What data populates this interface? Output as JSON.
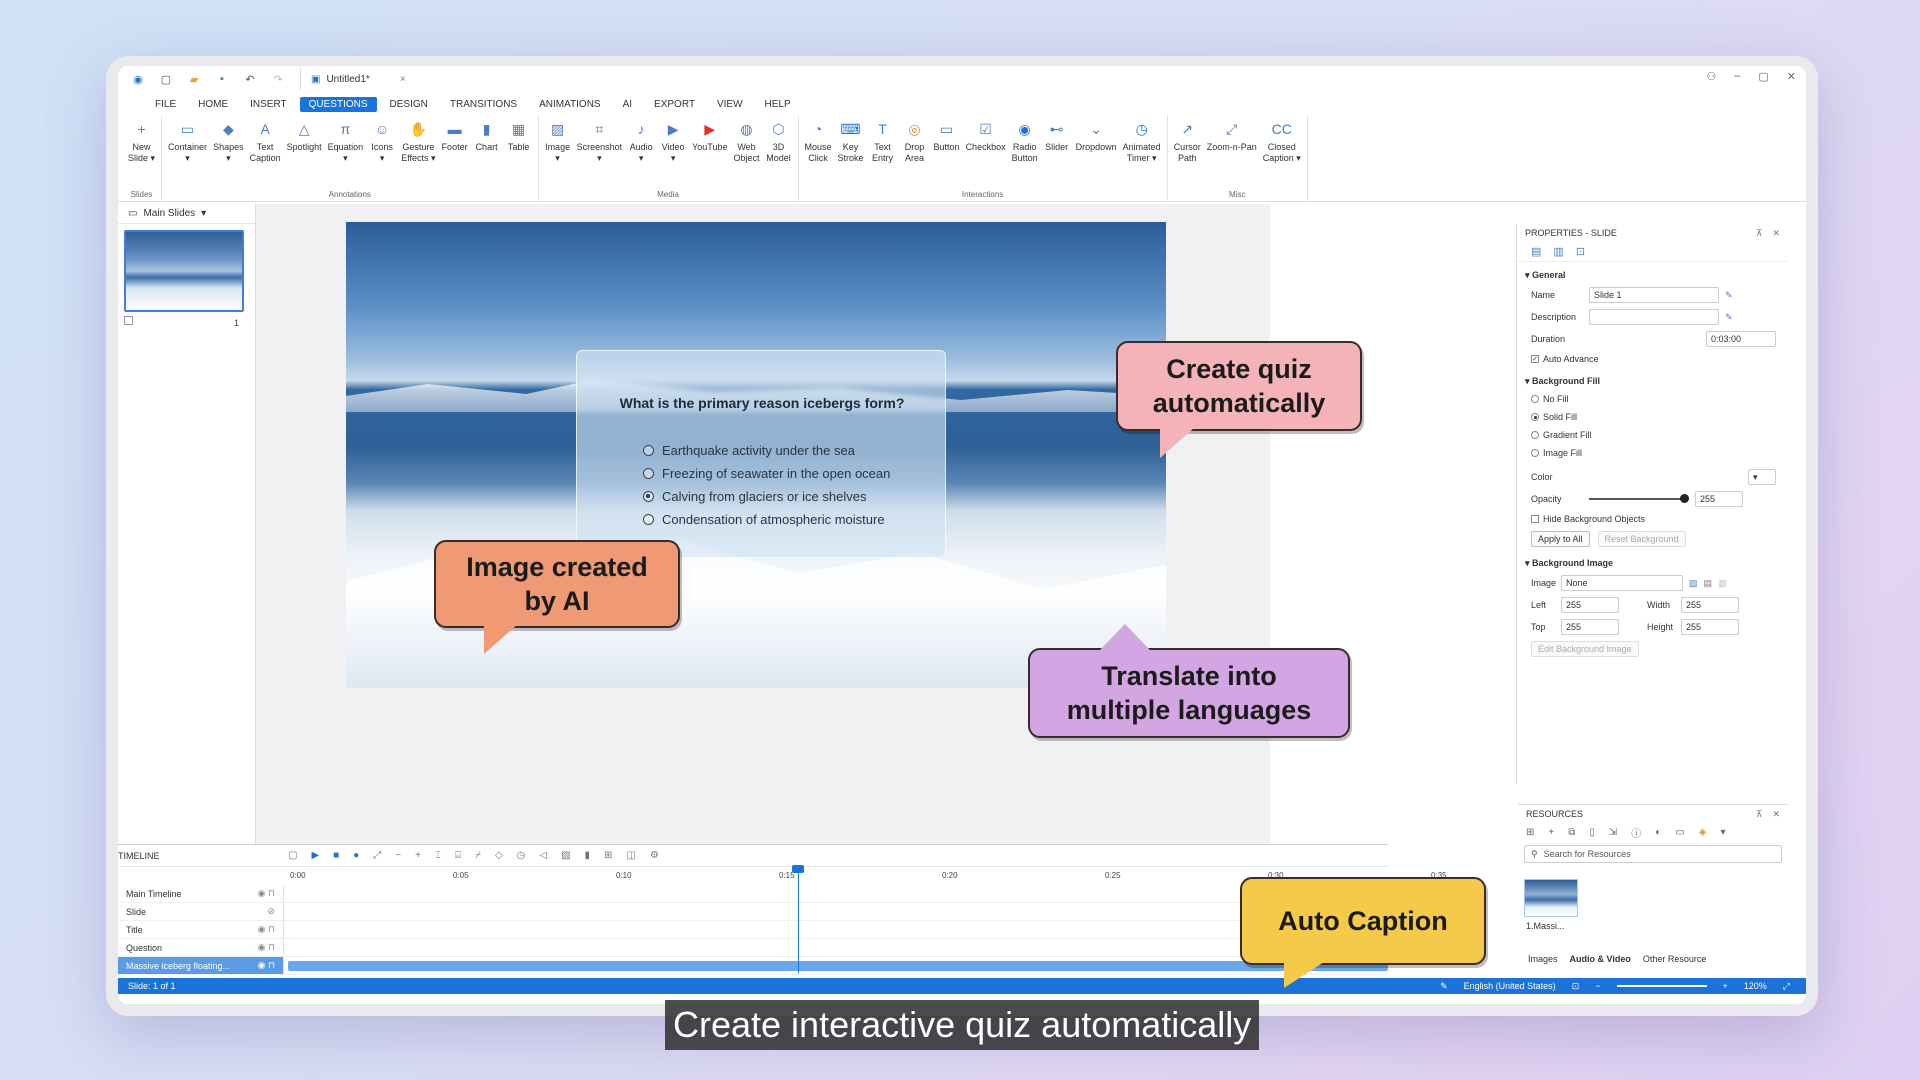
{
  "titlebar": {
    "doc_title": "Untitled1*",
    "close": "×"
  },
  "menu": [
    "FILE",
    "HOME",
    "INSERT",
    "QUESTIONS",
    "DESIGN",
    "TRANSITIONS",
    "ANIMATIONS",
    "AI",
    "EXPORT",
    "VIEW",
    "HELP"
  ],
  "ribbon": {
    "groups": [
      {
        "label": "Slides",
        "items": [
          {
            "label": "New\nSlide ▾",
            "icon": "+"
          }
        ]
      },
      {
        "label": "Annotations",
        "items": [
          {
            "label": "Container\n▾",
            "icon": "▭"
          },
          {
            "label": "Shapes\n▾",
            "icon": "◆"
          },
          {
            "label": "Text\nCaption",
            "icon": "A"
          },
          {
            "label": "Spotlight",
            "icon": "△"
          },
          {
            "label": "Equation\n▾",
            "icon": "π"
          },
          {
            "label": "Icons\n▾",
            "icon": "☺"
          },
          {
            "label": "Gesture\nEffects ▾",
            "icon": "✋"
          },
          {
            "label": "Footer",
            "icon": "▬"
          },
          {
            "label": "Chart",
            "icon": "▮"
          },
          {
            "label": "Table",
            "icon": "▦"
          }
        ]
      },
      {
        "label": "Media",
        "items": [
          {
            "label": "Image\n▾",
            "icon": "▨"
          },
          {
            "label": "Screenshot\n▾",
            "icon": "⌗"
          },
          {
            "label": "Audio\n▾",
            "icon": "♪"
          },
          {
            "label": "Video\n▾",
            "icon": "▶"
          },
          {
            "label": "YouTube",
            "icon": "▶"
          },
          {
            "label": "Web\nObject",
            "icon": "◍"
          },
          {
            "label": "3D\nModel",
            "icon": "⬡"
          }
        ]
      },
      {
        "label": "Interactions",
        "items": [
          {
            "label": "Mouse\nClick",
            "icon": "◔"
          },
          {
            "label": "Key\nStroke",
            "icon": "⌨"
          },
          {
            "label": "Text\nEntry",
            "icon": "T"
          },
          {
            "label": "Drop\nArea",
            "icon": "◎"
          },
          {
            "label": "Button",
            "icon": "▭"
          },
          {
            "label": "Checkbox",
            "icon": "☑"
          },
          {
            "label": "Radio\nButton",
            "icon": "◉"
          },
          {
            "label": "Slider",
            "icon": "⊷"
          },
          {
            "label": "Dropdown",
            "icon": "⌄"
          },
          {
            "label": "Animated\nTimer ▾",
            "icon": "◷"
          }
        ]
      },
      {
        "label": "Misc",
        "items": [
          {
            "label": "Cursor\nPath",
            "icon": "↗"
          },
          {
            "label": "Zoom-n-Pan",
            "icon": "⤢"
          },
          {
            "label": "Closed\nCaption ▾",
            "icon": "CC"
          }
        ]
      }
    ]
  },
  "slides_panel": {
    "title": "Main Slides",
    "slide_number": "1"
  },
  "quiz": {
    "question": "What is the primary reason icebergs form?",
    "options": [
      "Earthquake activity under the sea",
      "Freezing of seawater in the open ocean",
      "Calving from glaciers or ice shelves",
      "Condensation of atmospheric moisture"
    ],
    "selected_index": 2
  },
  "callouts": {
    "quiz": "Create quiz\nautomatically",
    "ai": "Image created\nby AI",
    "translate": "Translate into\nmultiple languages",
    "caption": "Auto Caption"
  },
  "properties": {
    "title": "PROPERTIES - SLIDE",
    "general": "General",
    "name_label": "Name",
    "name_value": "Slide 1",
    "description_label": "Description",
    "description_value": "",
    "duration_label": "Duration",
    "duration_value": "0:03:00",
    "auto_advance": "Auto Advance",
    "bg_fill": "Background Fill",
    "fill_options": [
      "No Fill",
      "Solid Fill",
      "Gradient Fill",
      "Image Fill"
    ],
    "fill_selected": 1,
    "color_label": "Color",
    "opacity_label": "Opacity",
    "opacity_value": "255",
    "hide_bg": "Hide Background Objects",
    "apply_all": "Apply to All",
    "reset_bg": "Reset Background",
    "bg_image": "Background Image",
    "image_label": "Image",
    "image_value": "None",
    "left_label": "Left",
    "left_value": "255",
    "width_label": "Width",
    "width_value": "255",
    "top_label": "Top",
    "top_value": "255",
    "height_label": "Height",
    "height_value": "255",
    "edit_bg": "Edit Background Image"
  },
  "resources": {
    "title": "RESOURCES",
    "search_placeholder": "Search for Resources",
    "item_name": "1.Massi...",
    "tabs": [
      "Images",
      "Audio & Video",
      "Other Resource"
    ]
  },
  "timeline": {
    "title": "TIMELINE",
    "ruler": [
      "0:00",
      "0:05",
      "0:10",
      "0:15",
      "0:20",
      "0:25",
      "0:30",
      "0:35"
    ],
    "rows": [
      "Main Timeline",
      "Slide",
      "Title",
      "Question",
      "Massive iceberg floating..."
    ]
  },
  "statusbar": {
    "slide_info": "Slide: 1 of 1",
    "language": "English (United States)",
    "zoom": "120%"
  },
  "subtitle": "Create interactive quiz automatically",
  "colors": {
    "accent": "#1a73d9",
    "quiz_callout": "#f4b3b8",
    "ai_callout": "#ef9a74",
    "translate_callout": "#d3a6e3",
    "caption_callout": "#f5c94a"
  }
}
